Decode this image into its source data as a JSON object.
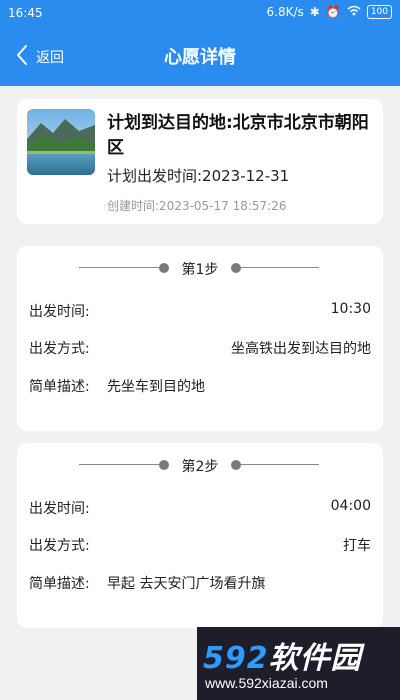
{
  "status_bar": {
    "time": "16:45",
    "network_speed": "6.8K/s",
    "battery": "100"
  },
  "nav": {
    "back_label": "返回",
    "title": "心愿详情"
  },
  "wish": {
    "title": "计划到达目的地:北京市北京市朝阳区",
    "planned_date": "计划出发时间:2023-12-31",
    "created": "创建时间:2023-05-17 18:57:26"
  },
  "steps": [
    {
      "label": "第1步",
      "depart_time_key": "出发时间:",
      "depart_time": "10:30",
      "depart_mode_key": "出发方式:",
      "depart_mode": "坐高铁出发到达目的地",
      "desc_key": "简单描述:",
      "desc": "先坐车到目的地"
    },
    {
      "label": "第2步",
      "depart_time_key": "出发时间:",
      "depart_time": "04:00",
      "depart_mode_key": "出发方式:",
      "depart_mode": "打车",
      "desc_key": "简单描述:",
      "desc": "早起 去天安门广场看升旗"
    }
  ],
  "watermark": {
    "number": "592",
    "text": "软件园",
    "url": "www.592xiazai.com"
  },
  "colors": {
    "primary": "#2a8cef",
    "background": "#f1f1f3",
    "card": "#ffffff",
    "muted": "#999999"
  }
}
